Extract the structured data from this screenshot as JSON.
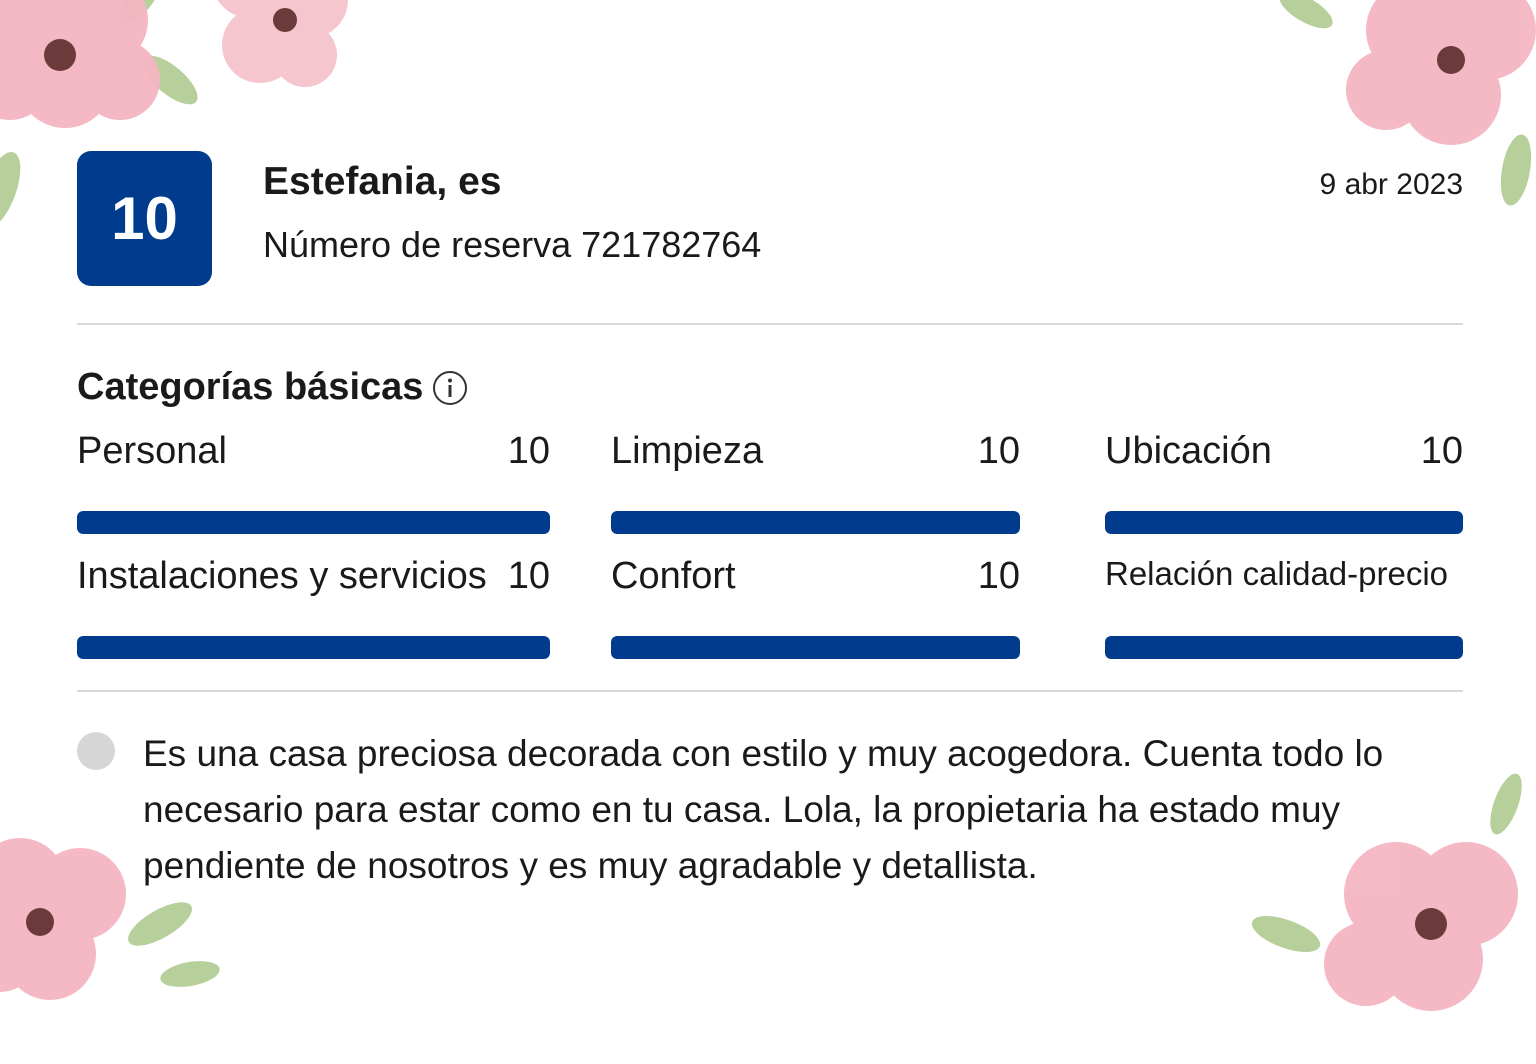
{
  "review": {
    "score": "10",
    "reviewer": "Estefania, es",
    "booking_number": "Número de reserva 721782764",
    "date": "9 abr 2023"
  },
  "categories": {
    "title": "Categorías básicas",
    "items": [
      {
        "label": "Personal",
        "score": "10",
        "fill": 1.0
      },
      {
        "label": "Limpieza",
        "score": "10",
        "fill": 1.0
      },
      {
        "label": "Ubicación",
        "score": "10",
        "fill": 1.0
      },
      {
        "label": "Instalaciones y servicios",
        "score": "10",
        "fill": 1.0
      },
      {
        "label": "Confort",
        "score": "10",
        "fill": 1.0
      },
      {
        "label": "Relación calidad-precio",
        "score": "",
        "fill": 1.0
      }
    ]
  },
  "comment": {
    "text": "Es una casa preciosa decorada con estilo y muy acogedora. Cuenta todo lo necesario para estar como en tu casa. Lola, la propietaria ha estado muy pendiente de nosotros y es muy agradable y detallista."
  },
  "colors": {
    "accent": "#003b8e",
    "divider": "#d8d8d8",
    "flower": "#f4b6c2",
    "leaf": "#b7cf9b"
  },
  "icons": {
    "info": "info-icon",
    "comment": "comment-bubble-icon",
    "decoration": "flower-icon"
  }
}
